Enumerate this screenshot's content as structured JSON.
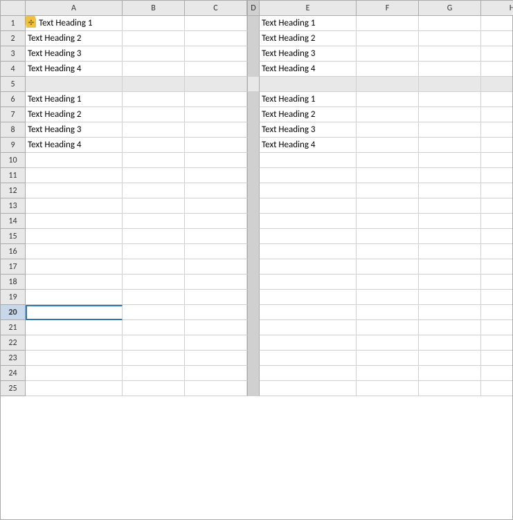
{
  "columns": [
    "A",
    "B",
    "C",
    "D",
    "E",
    "F",
    "G",
    "H"
  ],
  "rows": [
    {
      "num": 1,
      "a": "Text Heading 1",
      "b": "",
      "c": "",
      "d": "",
      "e": "Text Heading 1",
      "f": "",
      "g": "",
      "h": ""
    },
    {
      "num": 2,
      "a": "Text Heading 2",
      "b": "",
      "c": "",
      "d": "",
      "e": "Text Heading 2",
      "f": "",
      "g": "",
      "h": ""
    },
    {
      "num": 3,
      "a": "Text Heading 3",
      "b": "",
      "c": "",
      "d": "",
      "e": "Text Heading 3",
      "f": "",
      "g": "",
      "h": ""
    },
    {
      "num": 4,
      "a": "Text Heading 4",
      "b": "",
      "c": "",
      "d": "",
      "e": "Text Heading 4",
      "f": "",
      "g": "",
      "h": ""
    },
    {
      "num": 5,
      "a": "",
      "b": "",
      "c": "",
      "d": "",
      "e": "",
      "f": "",
      "g": "",
      "h": "",
      "divider": true
    },
    {
      "num": 6,
      "a": "Text Heading 1",
      "b": "",
      "c": "",
      "d": "",
      "e": "Text Heading 1",
      "f": "",
      "g": "",
      "h": ""
    },
    {
      "num": 7,
      "a": "Text Heading 2",
      "b": "",
      "c": "",
      "d": "",
      "e": "Text Heading 2",
      "f": "",
      "g": "",
      "h": ""
    },
    {
      "num": 8,
      "a": "Text Heading 3",
      "b": "",
      "c": "",
      "d": "",
      "e": "Text Heading 3",
      "f": "",
      "g": "",
      "h": ""
    },
    {
      "num": 9,
      "a": "Text Heading 4",
      "b": "",
      "c": "",
      "d": "",
      "e": "Text Heading 4",
      "f": "",
      "g": "",
      "h": ""
    },
    {
      "num": 10
    },
    {
      "num": 11
    },
    {
      "num": 12
    },
    {
      "num": 13
    },
    {
      "num": 14
    },
    {
      "num": 15
    },
    {
      "num": 16
    },
    {
      "num": 17
    },
    {
      "num": 18
    },
    {
      "num": 19
    },
    {
      "num": 20,
      "selected": true
    },
    {
      "num": 21
    },
    {
      "num": 22
    },
    {
      "num": 23
    },
    {
      "num": 24
    },
    {
      "num": 25
    }
  ],
  "col_widths": {
    "A": 140,
    "B": 90,
    "C": 90,
    "D": 18,
    "E": 140,
    "F": 90,
    "G": 90,
    "H": 90
  }
}
